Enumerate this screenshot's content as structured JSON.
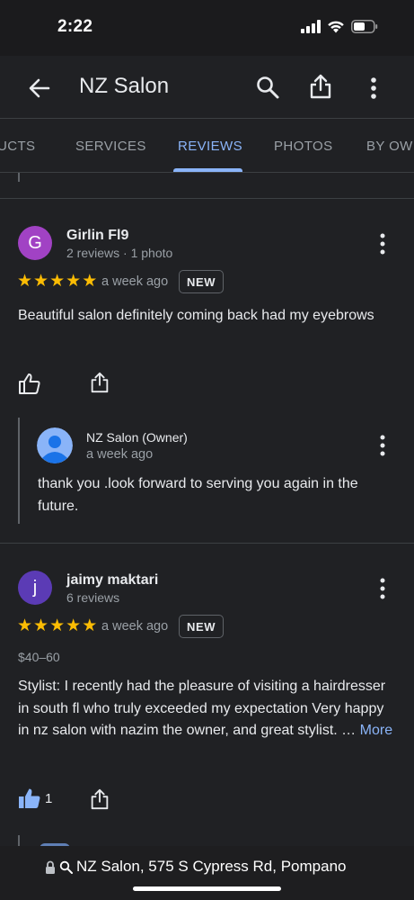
{
  "status_bar": {
    "time": "2:22"
  },
  "app_bar": {
    "title": "NZ Salon"
  },
  "tabs": [
    {
      "label": "PRODUCTS",
      "visible_label": "UCTS"
    },
    {
      "label": "SERVICES"
    },
    {
      "label": "REVIEWS",
      "active": true
    },
    {
      "label": "PHOTOS"
    },
    {
      "label": "BY OWNER",
      "visible_label": "BY OWI"
    }
  ],
  "reviews": [
    {
      "avatar_letter": "G",
      "avatar_color": "#a142c4",
      "name": "Girlin Fl9",
      "meta": "2 reviews · 1 photo",
      "rating": 5,
      "time": "a week ago",
      "badge": "NEW",
      "text": "Beautiful salon definitely coming back had my eyebrows",
      "owner_reply": {
        "name": "NZ Salon (Owner)",
        "time": "a week ago",
        "text": "thank you .look forward to serving you again in the future."
      }
    },
    {
      "avatar_letter": "j",
      "avatar_color": "#5b3bb5",
      "name": "jaimy maktari",
      "meta": "6 reviews",
      "rating": 5,
      "time": "a week ago",
      "badge": "NEW",
      "price": "$40–60",
      "text": "Stylist: I recently had the pleasure of visiting a hairdresser in south fl who truly exceeded my expectation Very happy in nz salon with nazim the owner, and great stylist. …",
      "more_label": "More",
      "likes": "1"
    }
  ],
  "url_bar": {
    "text": "NZ Salon, 575 S Cypress Rd, Pompano"
  },
  "colors": {
    "accent": "#8ab4f8",
    "star": "#fbbc04",
    "background": "#202124"
  }
}
